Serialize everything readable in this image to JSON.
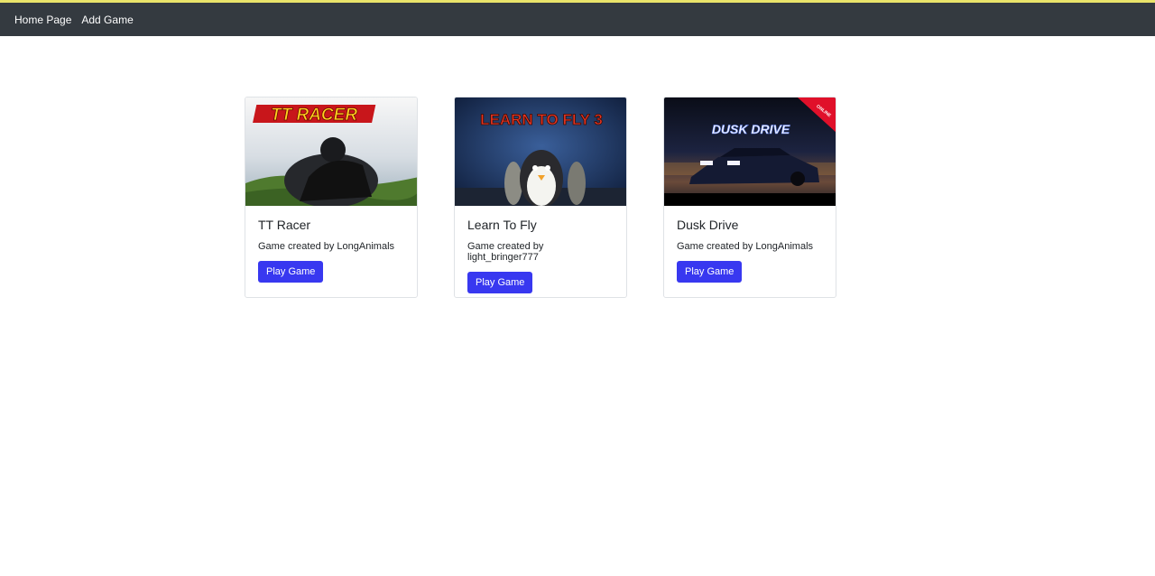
{
  "colors": {
    "navbar": "#343a40",
    "topline": "#e9e36a",
    "button": "#3838f0"
  },
  "nav": {
    "items": [
      {
        "label": "Home Page"
      },
      {
        "label": "Add Game"
      }
    ]
  },
  "games": [
    {
      "title": "TT Racer",
      "creator": "Game created by LongAnimals",
      "button": "Play Game",
      "thumb_text": "TT RACER"
    },
    {
      "title": "Learn To Fly",
      "creator": "Game created by light_bringer777",
      "button": "Play Game",
      "thumb_text": "LEARN TO FLY 3"
    },
    {
      "title": "Dusk Drive",
      "creator": "Game created by LongAnimals",
      "button": "Play Game",
      "thumb_text": "DUSK DRIVE",
      "ribbon_text": "ONLINE"
    }
  ]
}
